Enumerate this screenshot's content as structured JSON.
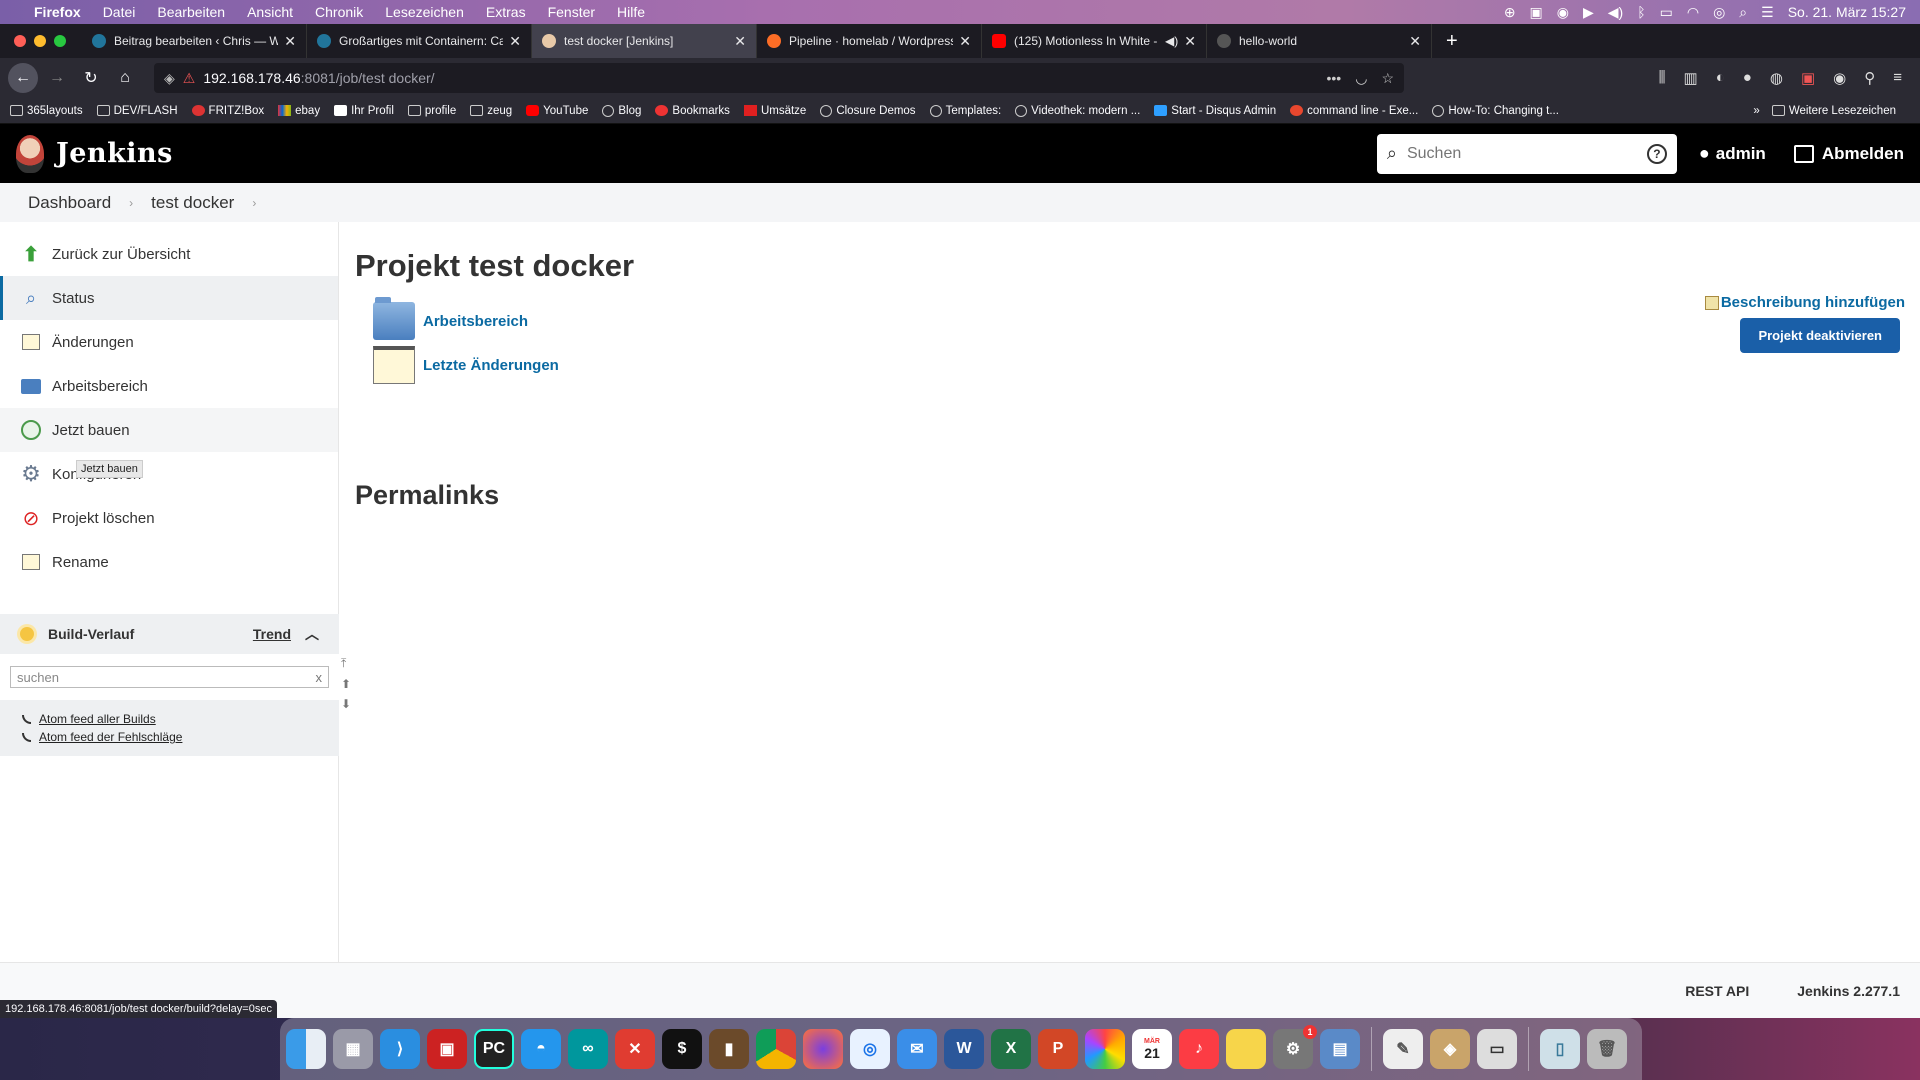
{
  "menubar": {
    "app": "Firefox",
    "items": [
      "Datei",
      "Bearbeiten",
      "Ansicht",
      "Chronik",
      "Lesezeichen",
      "Extras",
      "Fenster",
      "Hilfe"
    ],
    "clock": "So. 21. März  15:27"
  },
  "tabs": [
    {
      "title": "Beitrag bearbeiten ‹ Chris — W",
      "color": "#21759b"
    },
    {
      "title": "Großartiges mit Containern: Ca",
      "color": "#21759b"
    },
    {
      "title": "test docker [Jenkins]",
      "color": "#d24939"
    },
    {
      "title": "Pipeline · homelab / Wordpress",
      "color": "#fc6d26"
    },
    {
      "title": "(125) Motionless In White -",
      "color": "#ff0000"
    },
    {
      "title": "hello-world",
      "color": "#555"
    }
  ],
  "url": {
    "host": "192.168.178.46",
    "path": ":8081/job/test docker/"
  },
  "bookmarks": [
    {
      "label": "365layouts",
      "icon": "folder"
    },
    {
      "label": "DEV/FLASH",
      "icon": "folder"
    },
    {
      "label": "FRITZ!Box",
      "icon": "fritz"
    },
    {
      "label": "ebay",
      "icon": "ebay"
    },
    {
      "label": "Ihr Profil",
      "icon": "amazon"
    },
    {
      "label": "profile",
      "icon": "folder"
    },
    {
      "label": "zeug",
      "icon": "folder"
    },
    {
      "label": "YouTube",
      "icon": "youtube"
    },
    {
      "label": "Blog",
      "icon": "globe"
    },
    {
      "label": "Bookmarks",
      "icon": "bookmarks"
    },
    {
      "label": "Umsätze",
      "icon": "bank"
    },
    {
      "label": "Closure Demos",
      "icon": "globe"
    },
    {
      "label": "Templates:",
      "icon": "globe"
    },
    {
      "label": "Videothek: modern ...",
      "icon": "globe"
    },
    {
      "label": "Start - Disqus Admin",
      "icon": "disqus"
    },
    {
      "label": "command line - Exe...",
      "icon": "ask"
    },
    {
      "label": "How-To: Changing t...",
      "icon": "globe"
    }
  ],
  "bookmarks_more": "Weitere Lesezeichen",
  "jenkins": {
    "title": "Jenkins",
    "search_placeholder": "Suchen",
    "user": "admin",
    "logout": "Abmelden"
  },
  "breadcrumb": [
    "Dashboard",
    "test docker"
  ],
  "sidebar": [
    {
      "label": "Zurück zur Übersicht",
      "icon": "up-arrow-icon"
    },
    {
      "label": "Status",
      "icon": "magnifier-icon"
    },
    {
      "label": "Änderungen",
      "icon": "notepad-icon"
    },
    {
      "label": "Arbeitsbereich",
      "icon": "folder-icon"
    },
    {
      "label": "Jetzt bauen",
      "icon": "build-clock-icon"
    },
    {
      "label": "Konfigurieren",
      "icon": "gear-icon"
    },
    {
      "label": "Projekt löschen",
      "icon": "no-entry-icon"
    },
    {
      "label": "Rename",
      "icon": "notepad-icon"
    }
  ],
  "tooltip": "Jetzt bauen",
  "build_history": {
    "title": "Build-Verlauf",
    "trend": "Trend",
    "search_placeholder": "suchen",
    "clear": "x",
    "feed_all": "Atom feed aller Builds",
    "feed_failures": "Atom feed der Fehlschläge"
  },
  "main": {
    "title": "Projekt test docker",
    "add_description": "Beschreibung hinzufügen",
    "disable_button": "Projekt deaktivieren",
    "workspace_link": "Arbeitsbereich",
    "changes_link": "Letzte Änderungen",
    "permalinks": "Permalinks"
  },
  "footer": {
    "rest_api": "REST API",
    "version": "Jenkins 2.277.1"
  },
  "status_url": "192.168.178.46:8081/job/test docker/build?delay=0sec",
  "colors": {
    "accent": "#0b6aa2",
    "button": "#1a5fa8",
    "header": "#000000"
  },
  "dock": [
    "finder",
    "launchpad",
    "vscode",
    "filezilla",
    "pycharm",
    "docker",
    "arduino",
    "remote-desktop",
    "terminal",
    "calibre",
    "chrome",
    "firefox",
    "safari",
    "mail",
    "word",
    "excel",
    "powerpoint",
    "photos",
    "calendar",
    "music",
    "notes",
    "system-preferences",
    "preview",
    "textedit",
    "ipad",
    "utility",
    "downloads",
    "trash"
  ],
  "calendar_day": "21",
  "calendar_month": "MÄR",
  "badge": "1"
}
